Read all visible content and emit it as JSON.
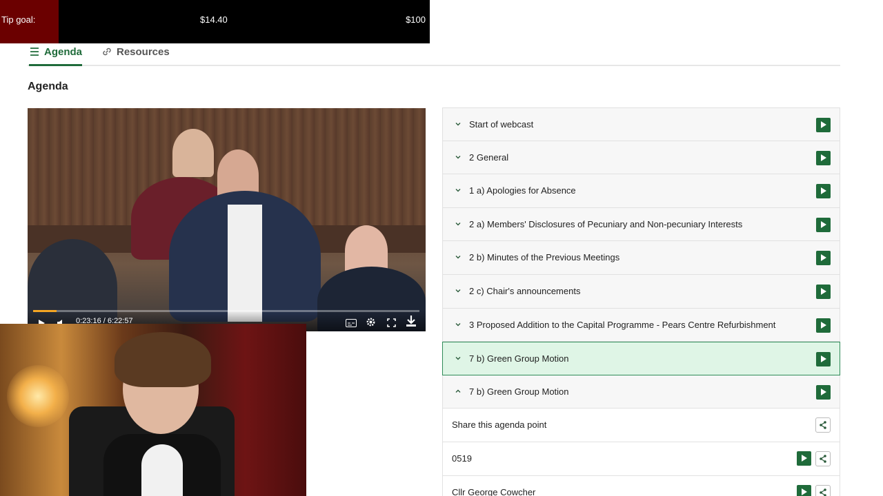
{
  "tip_goal": {
    "label": "Tip goal:",
    "current": "$14.40",
    "goal": "$100",
    "progress_fraction": 0.144
  },
  "tabs": [
    {
      "label": "Agenda",
      "icon": "list-icon",
      "active": true
    },
    {
      "label": "Resources",
      "icon": "link-icon",
      "active": false
    }
  ],
  "page_title": "Agenda",
  "video": {
    "time_current": "0:23:16",
    "time_separator": "/",
    "time_total": "6:22:57",
    "progress_fraction": 0.061
  },
  "agenda_items": [
    {
      "label": "Start of webcast",
      "expanded": false,
      "highlight": false
    },
    {
      "label": "2 General",
      "expanded": false,
      "highlight": false
    },
    {
      "label": "1 a) Apologies for Absence",
      "expanded": false,
      "highlight": false
    },
    {
      "label": "2 a) Members' Disclosures of Pecuniary and Non-pecuniary Interests",
      "expanded": false,
      "highlight": false
    },
    {
      "label": "2 b) Minutes of the Previous Meetings",
      "expanded": false,
      "highlight": false
    },
    {
      "label": "2 c) Chair's announcements",
      "expanded": false,
      "highlight": false
    },
    {
      "label": "3 Proposed Addition to the Capital Programme - Pears Centre Refurbishment",
      "expanded": false,
      "highlight": false
    },
    {
      "label": "7 b) Green Group Motion",
      "expanded": false,
      "highlight": true
    },
    {
      "label": "7 b) Green Group Motion",
      "expanded": true,
      "highlight": false
    }
  ],
  "sub_items": [
    {
      "label": "Share this agenda point",
      "has_play": false
    },
    {
      "label": "0519",
      "has_play": true
    },
    {
      "label": "Cllr George Cowcher",
      "has_play": true
    }
  ],
  "colors": {
    "accent": "#1f6b3a",
    "highlight_bg": "#dff5e6",
    "tip_fill": "#6b0000"
  }
}
